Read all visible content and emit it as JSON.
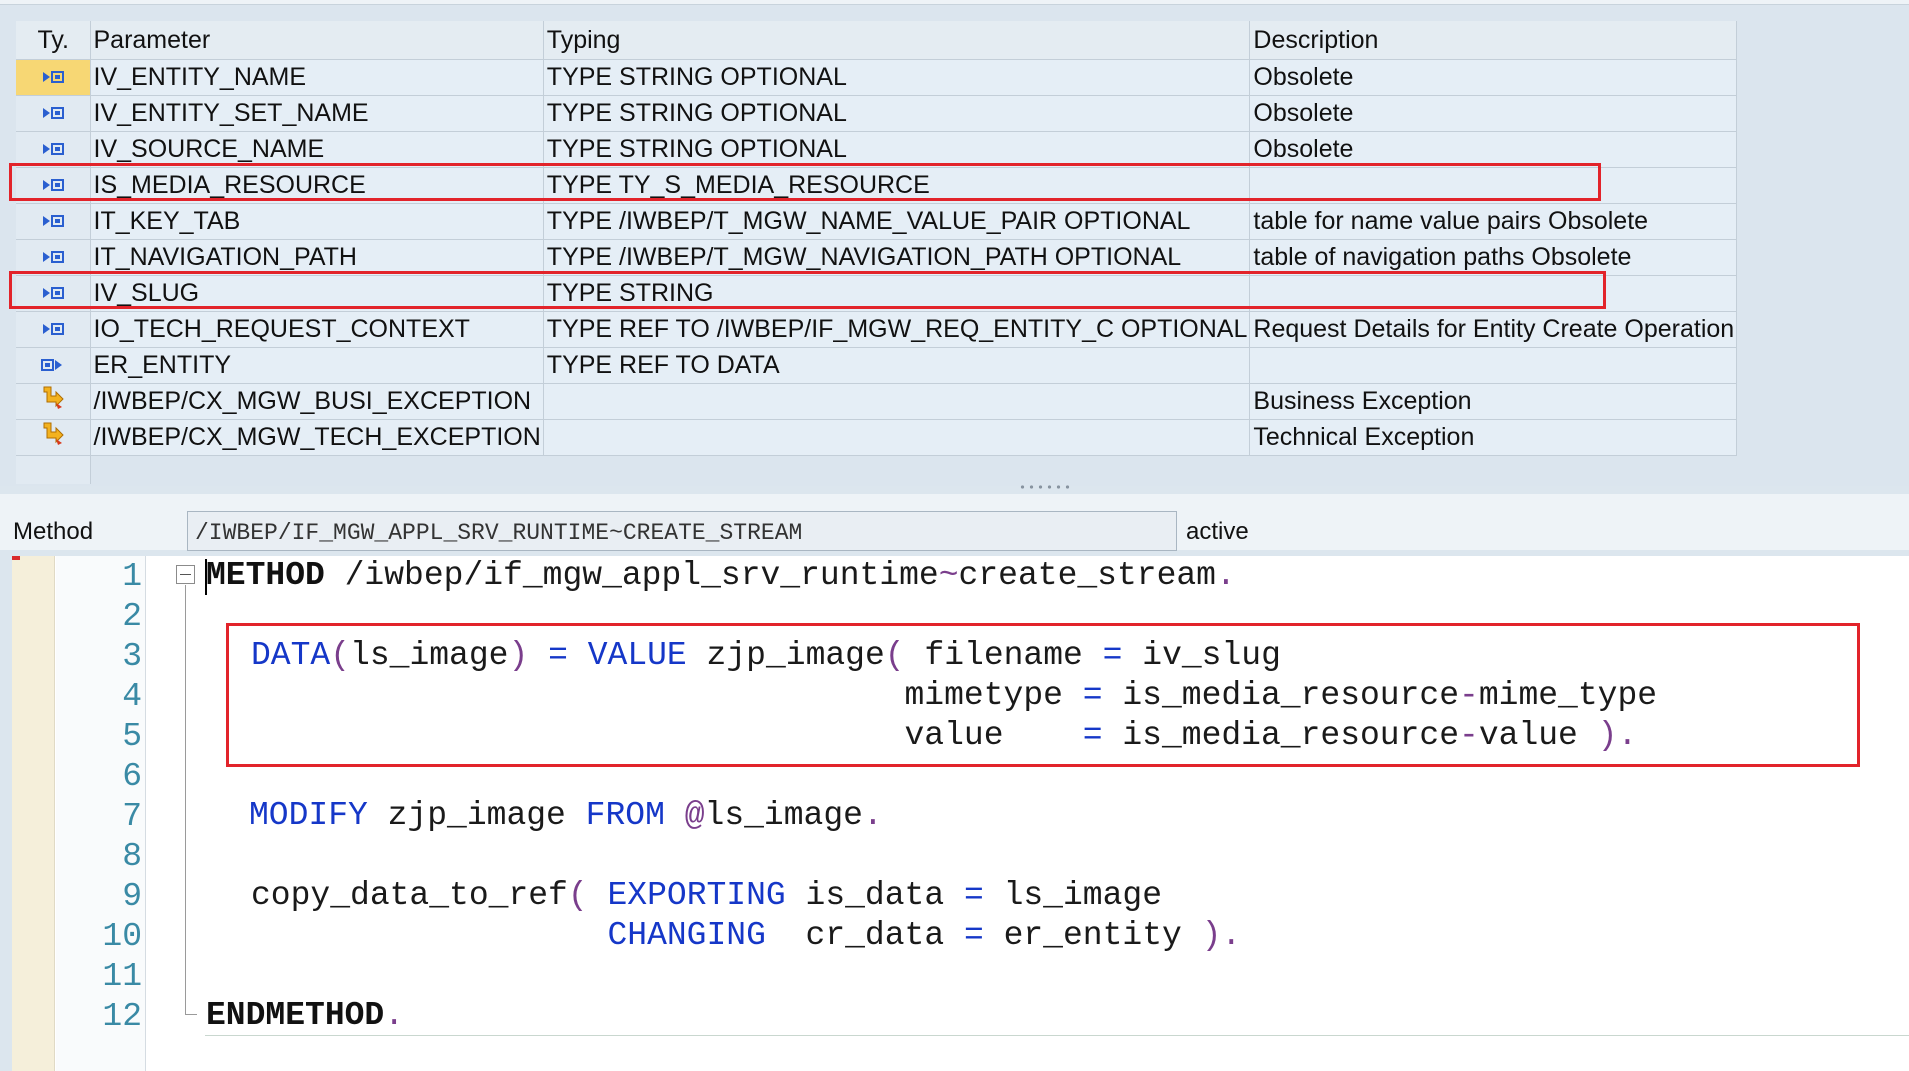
{
  "grid": {
    "headers": [
      "Ty.",
      "Parameter",
      "Typing",
      "Description"
    ],
    "rows": [
      {
        "icon": "importing-parameter-icon",
        "name": "IV_ENTITY_NAME",
        "typing": "TYPE STRING OPTIONAL",
        "description": "Obsolete",
        "selected": true
      },
      {
        "icon": "importing-parameter-icon",
        "name": "IV_ENTITY_SET_NAME",
        "typing": "TYPE STRING OPTIONAL",
        "description": "Obsolete"
      },
      {
        "icon": "importing-parameter-icon",
        "name": "IV_SOURCE_NAME",
        "typing": "TYPE STRING OPTIONAL",
        "description": "Obsolete"
      },
      {
        "icon": "importing-parameter-icon",
        "name": "IS_MEDIA_RESOURCE",
        "typing": "TYPE TY_S_MEDIA_RESOURCE",
        "description": "",
        "highlighted": true
      },
      {
        "icon": "importing-parameter-icon",
        "name": "IT_KEY_TAB",
        "typing": "TYPE /IWBEP/T_MGW_NAME_VALUE_PAIR OPTIONAL",
        "description": "table for name value pairs Obsolete"
      },
      {
        "icon": "importing-parameter-icon",
        "name": "IT_NAVIGATION_PATH",
        "typing": "TYPE /IWBEP/T_MGW_NAVIGATION_PATH OPTIONAL",
        "description": "table of navigation paths Obsolete"
      },
      {
        "icon": "importing-parameter-icon",
        "name": "IV_SLUG",
        "typing": "TYPE STRING",
        "description": "",
        "highlighted": true
      },
      {
        "icon": "importing-parameter-icon",
        "name": "IO_TECH_REQUEST_CONTEXT",
        "typing": "TYPE REF TO /IWBEP/IF_MGW_REQ_ENTITY_C OPTIONAL",
        "description": "Request Details for Entity Create Operation"
      },
      {
        "icon": "exporting-parameter-icon",
        "name": "ER_ENTITY",
        "typing": "TYPE REF TO DATA",
        "description": ""
      },
      {
        "icon": "exception-icon",
        "name": "/IWBEP/CX_MGW_BUSI_EXCEPTION",
        "typing": "",
        "description": "Business Exception"
      },
      {
        "icon": "exception-icon",
        "name": "/IWBEP/CX_MGW_TECH_EXCEPTION",
        "typing": "",
        "description": "Technical Exception"
      }
    ]
  },
  "method": {
    "label": "Method",
    "name": "/IWBEP/IF_MGW_APPL_SRV_RUNTIME~CREATE_STREAM",
    "status": "active"
  },
  "editor": {
    "line_numbers": [
      "1",
      "2",
      "3",
      "4",
      "5",
      "6",
      "7",
      "8",
      "9",
      "10",
      "11",
      "12"
    ],
    "colors": {
      "keyword": "#1537c8",
      "punct": "#7a3e8c",
      "text": "#1a1a1a",
      "line_number": "#3a8aa5",
      "highlight": "#e2232a"
    }
  }
}
